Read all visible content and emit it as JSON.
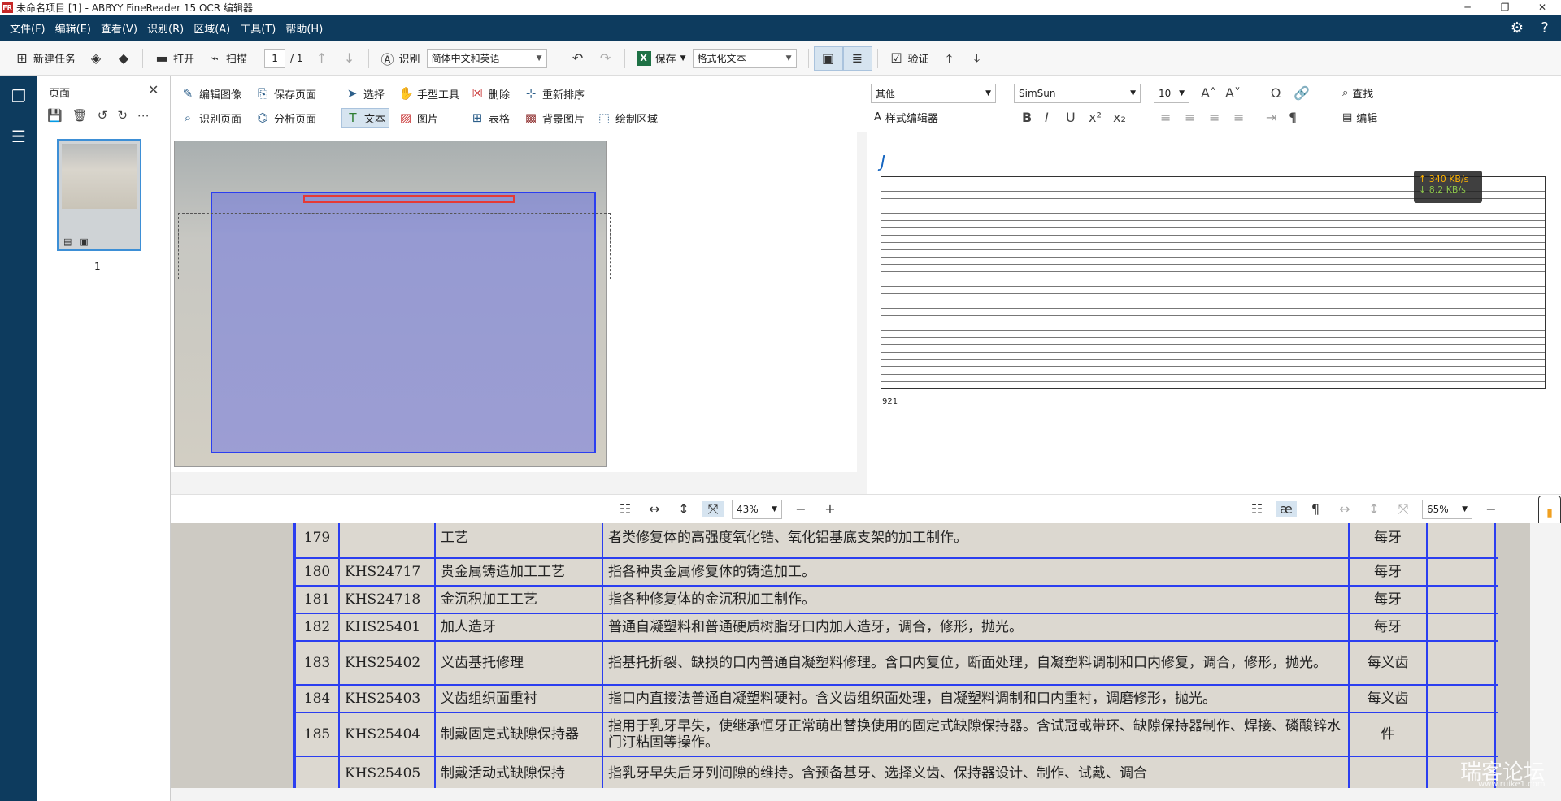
{
  "window": {
    "title": "未命名项目 [1] - ABBYY FineReader 15 OCR 编辑器",
    "logo": "FR"
  },
  "menu": [
    "文件(F)",
    "编辑(E)",
    "查看(V)",
    "识别(R)",
    "区域(A)",
    "工具(T)",
    "帮助(H)"
  ],
  "toolbar": {
    "new_task": "新建任务",
    "open": "打开",
    "scan": "扫描",
    "page_current": "1",
    "page_total": "/ 1",
    "recognize": "识别",
    "language": "简体中文和英语",
    "save": "保存",
    "format": "格式化文本",
    "verify": "验证"
  },
  "pages_panel": {
    "title": "页面",
    "page_number": "1"
  },
  "image_toolbar": {
    "edit_image": "编辑图像",
    "save_page": "保存页面",
    "recognize_page": "识别页面",
    "analyze_page": "分析页面",
    "select": "选择",
    "hand_tool": "手型工具",
    "delete": "删除",
    "reorder": "重新排序",
    "text": "文本",
    "picture": "图片",
    "table": "表格",
    "bg_picture": "背景图片",
    "draw_area": "绘制区域"
  },
  "image_zoom": "43%",
  "text_toolbar": {
    "style": "其他",
    "font": "SimSun",
    "size": "10",
    "style_editor": "样式编辑器",
    "find": "查找",
    "edit": "编辑"
  },
  "text_zoom": "65%",
  "text_doc": {
    "heading": "J",
    "footer": "921"
  },
  "speed": {
    "up": "↑ 340 KB/s",
    "down": "↓ 8.2 KB/s"
  },
  "zoom_rows": [
    {
      "no": "179",
      "code": "",
      "name": "工艺",
      "desc": "者类修复体的高强度氧化锆、氧化铝基底支架的加工制作。",
      "unit": "每牙"
    },
    {
      "no": "180",
      "code": "KHS24717",
      "name": "贵金属铸造加工工艺",
      "desc": "指各种贵金属修复体的铸造加工。",
      "unit": "每牙"
    },
    {
      "no": "181",
      "code": "KHS24718",
      "name": "金沉积加工工艺",
      "desc": "指各种修复体的金沉积加工制作。",
      "unit": "每牙"
    },
    {
      "no": "182",
      "code": "KHS25401",
      "name": "加人造牙",
      "desc": "普通自凝塑料和普通硬质树脂牙口内加人造牙，调合，修形，抛光。",
      "unit": "每牙"
    },
    {
      "no": "183",
      "code": "KHS25402",
      "name": "义齿基托修理",
      "desc": "指基托折裂、缺损的口内普通自凝塑料修理。含口内复位，断面处理，自凝塑料调制和口内修复，调合，修形，抛光。",
      "unit": "每义齿"
    },
    {
      "no": "184",
      "code": "KHS25403",
      "name": "义齿组织面重衬",
      "desc": "指口内直接法普通自凝塑料硬衬。含义齿组织面处理，自凝塑料调制和口内重衬，调磨修形，抛光。",
      "unit": "每义齿"
    },
    {
      "no": "185",
      "code": "KHS25404",
      "name": "制戴固定式缺隙保持器",
      "desc": "指用于乳牙早失，使继承恒牙正常萌出替换使用的固定式缺隙保持器。含试冠或带环、缺隙保持器制作、焊接、磷酸锌水门汀粘固等操作。",
      "unit": "件"
    },
    {
      "no": "",
      "code": "KHS25405",
      "name": "制戴活动式缺隙保持",
      "desc": "指乳牙早失后牙列间隙的维持。含预备基牙、选择义齿、保持器设计、制作、试戴、调合",
      "unit": ""
    }
  ],
  "watermark": "瑞客论坛",
  "watermark_sub": "www.ruike1.com"
}
